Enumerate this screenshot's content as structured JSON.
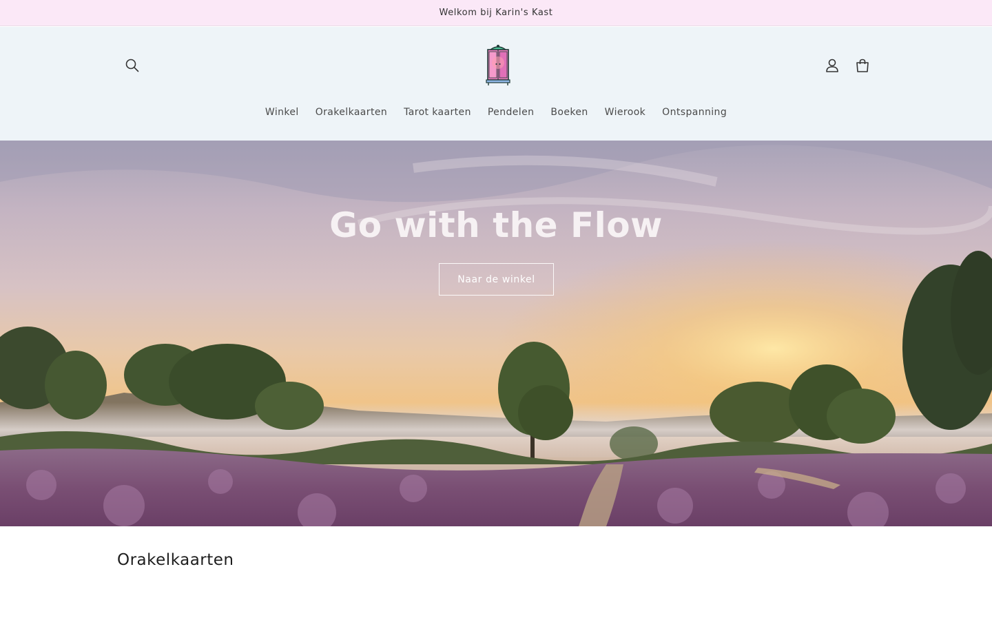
{
  "announcement": {
    "text": "Welkom bij Karin's Kast"
  },
  "header": {
    "logo_name": "karins-kast-logo",
    "icons": {
      "search": "search-icon",
      "account": "account-icon",
      "cart": "cart-icon"
    },
    "nav": [
      {
        "label": "Winkel"
      },
      {
        "label": "Orakelkaarten"
      },
      {
        "label": "Tarot kaarten"
      },
      {
        "label": "Pendelen"
      },
      {
        "label": "Boeken"
      },
      {
        "label": "Wierook"
      },
      {
        "label": "Ontspanning"
      }
    ]
  },
  "hero": {
    "title": "Go with the Flow",
    "button_label": "Naar de winkel"
  },
  "section": {
    "title": "Orakelkaarten"
  },
  "colors": {
    "announcement_bg": "#fbe8f7",
    "header_bg": "#eef4f8",
    "page_bg": "#ffffff"
  }
}
